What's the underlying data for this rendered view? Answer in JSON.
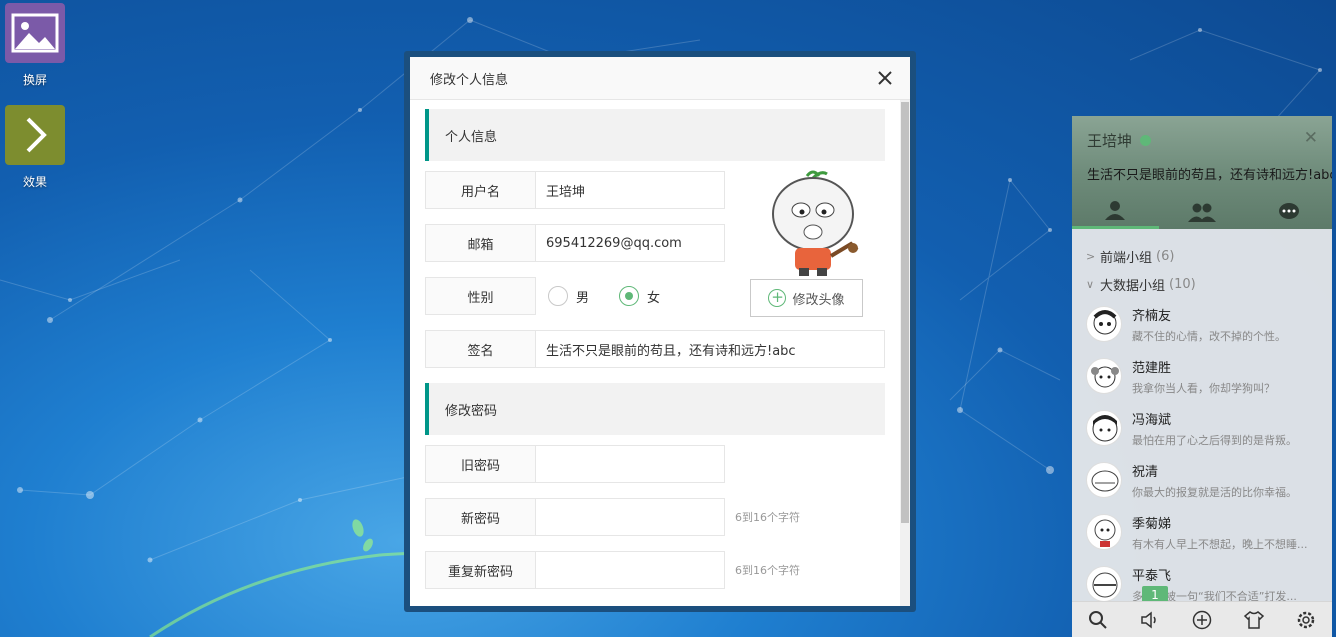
{
  "desktop": {
    "icons": [
      {
        "label": "换屏",
        "icon": "image-icon",
        "color": "#7b5aa8"
      },
      {
        "label": "效果",
        "icon": "chevron-right-icon",
        "color": "#7d8d2f"
      }
    ]
  },
  "modal": {
    "title": "修改个人信息",
    "section_profile": "个人信息",
    "username_label": "用户名",
    "username_value": "王培坤",
    "email_label": "邮箱",
    "email_value": "695412269@qq.com",
    "gender_label": "性别",
    "gender_options": [
      "男",
      "女"
    ],
    "gender_selected": "女",
    "signature_label": "签名",
    "signature_value": "生活不只是眼前的苟且，还有诗和远方!abc",
    "change_avatar_label": "修改头像",
    "section_password": "修改密码",
    "old_password_label": "旧密码",
    "new_password_label": "新密码",
    "new_password_hint": "6到16个字符",
    "repeat_password_label": "重复新密码",
    "repeat_password_hint": "6到16个字符"
  },
  "chat": {
    "user_name": "王培坤",
    "signature": "生活不只是眼前的苟且，还有诗和远方!abc",
    "status_color": "#5FB878",
    "tabs": [
      "friends-tab",
      "groups-tab",
      "history-tab"
    ],
    "groups": [
      {
        "name": "前端小组",
        "count": "(6)",
        "expanded": false
      },
      {
        "name": "大数据小组",
        "count": "(10)",
        "expanded": true
      }
    ],
    "friends": [
      {
        "name": "齐楠友",
        "sign": "藏不住的心情，改不掉的个性。"
      },
      {
        "name": "范建胜",
        "sign": "我拿你当人看，你却学狗叫？"
      },
      {
        "name": "冯海斌",
        "sign": "最怕在用了心之后得到的是背叛。"
      },
      {
        "name": "祝清",
        "sign": "你最大的报复就是活的比你幸福。"
      },
      {
        "name": "季菊娣",
        "sign": "有木有人早上不想起，晚上不想睡..."
      },
      {
        "name": "平泰飞",
        "sign": "多少人被一句“我们不合适”打发..."
      }
    ],
    "badge": "1",
    "accent": "#5FB878"
  }
}
